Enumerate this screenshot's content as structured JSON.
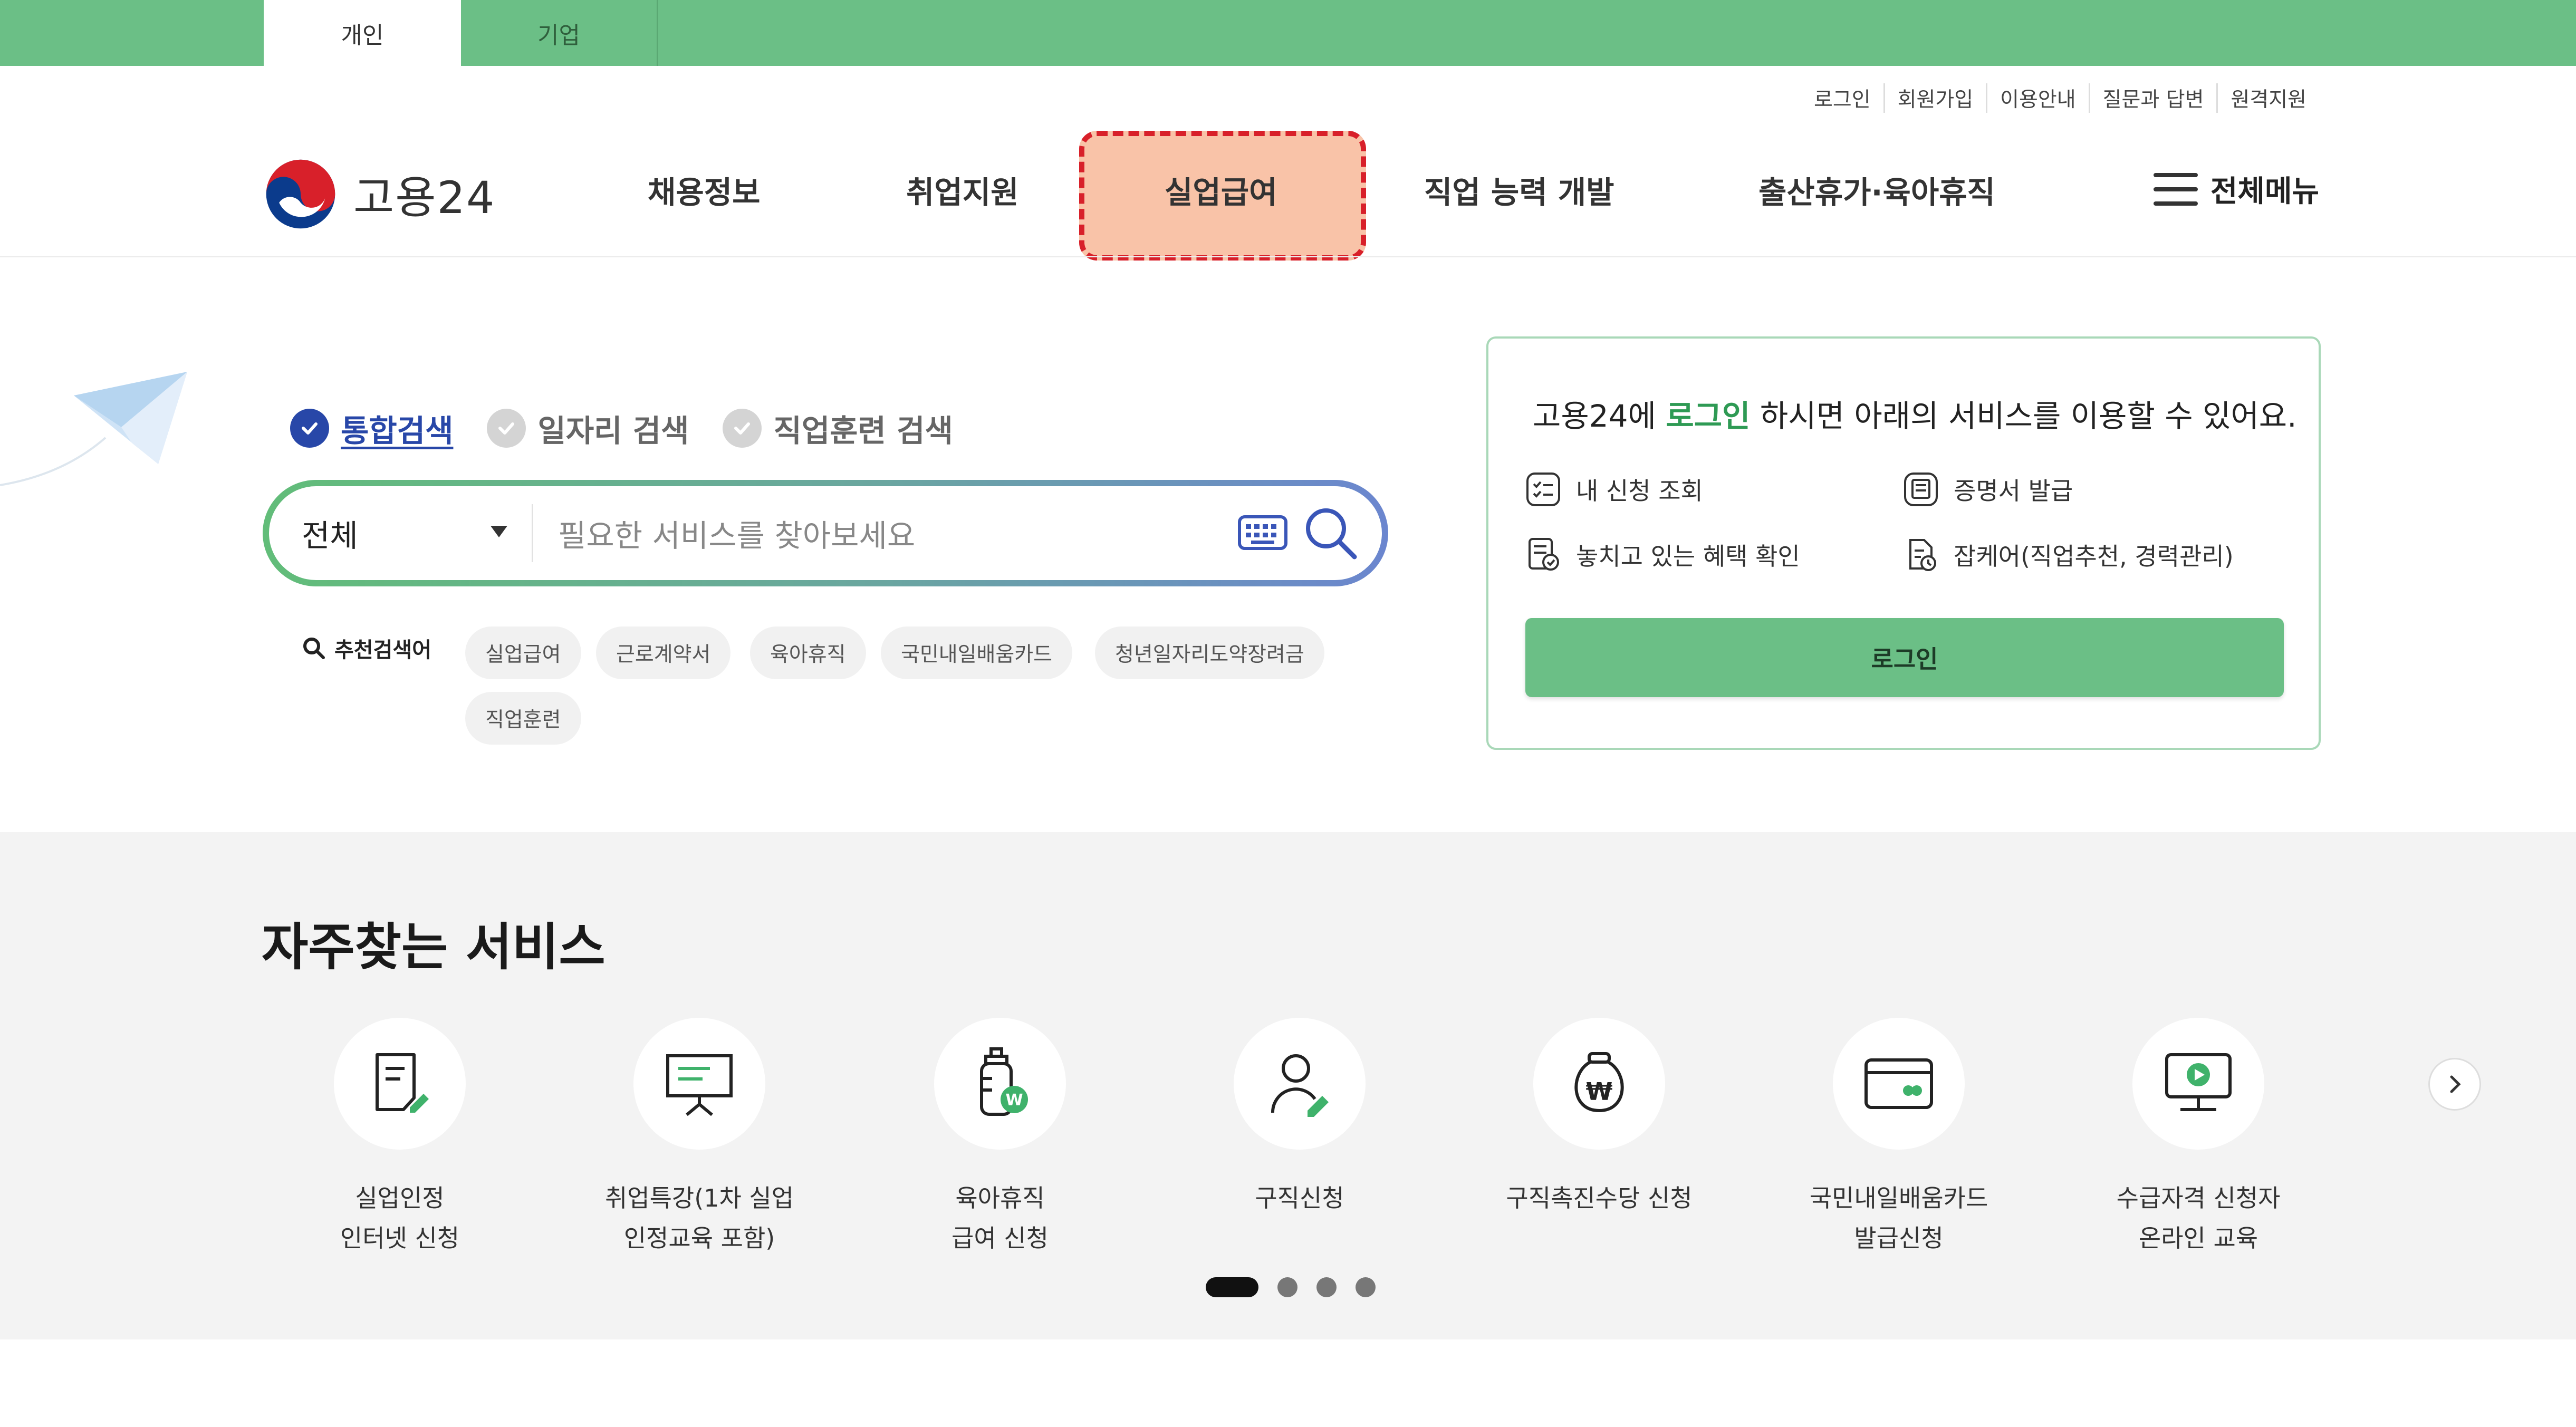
{
  "topbar": {
    "tabs": [
      {
        "label": "개인",
        "active": true
      },
      {
        "label": "기업",
        "active": false
      }
    ],
    "color": "#6bbf86"
  },
  "util_links": [
    "로그인",
    "회원가입",
    "이용안내",
    "질문과 답변",
    "원격지원"
  ],
  "header": {
    "logo_text": "고용24",
    "nav": [
      "채용정보",
      "취업지원",
      "실업급여",
      "직업 능력 개발",
      "출산휴가·육아휴직"
    ],
    "highlighted_nav": "실업급여",
    "all_menu": "전체메뉴"
  },
  "search": {
    "tabs": [
      {
        "label": "통합검색",
        "active": true
      },
      {
        "label": "일자리 검색",
        "active": false
      },
      {
        "label": "직업훈련 검색",
        "active": false
      }
    ],
    "select_value": "전체",
    "placeholder": "필요한 서비스를 찾아보세요",
    "recommend_label": "추천검색어",
    "keywords": [
      "실업급여",
      "근로계약서",
      "육아휴직",
      "국민내일배움카드",
      "청년일자리도약장려금",
      "직업훈련"
    ]
  },
  "login_box": {
    "title_prefix": "고용24에 ",
    "title_highlight": "로그인",
    "title_suffix": " 하시면 아래의 서비스를 이용할 수 있어요.",
    "items": [
      "내 신청 조회",
      "증명서 발급",
      "놓치고 있는 혜택 확인",
      "잡케어(직업추천, 경력관리)"
    ],
    "button": "로그인"
  },
  "services": {
    "title": "자주찾는 서비스",
    "items": [
      {
        "label": "실업인정\n인터넷 신청",
        "icon": "document-pen-icon"
      },
      {
        "label": "취업특강(1차 실업\n인정교육 포함)",
        "icon": "presentation-board-icon"
      },
      {
        "label": "육아휴직\n급여 신청",
        "icon": "baby-bottle-won-icon"
      },
      {
        "label": "구직신청",
        "icon": "person-pen-icon"
      },
      {
        "label": "구직촉진수당 신청",
        "icon": "money-bag-won-icon"
      },
      {
        "label": "국민내일배움카드\n발급신청",
        "icon": "card-icon"
      },
      {
        "label": "수급자격 신청자\n온라인 교육",
        "icon": "monitor-play-icon"
      }
    ],
    "pagination": {
      "current": 1,
      "total": 4
    }
  }
}
